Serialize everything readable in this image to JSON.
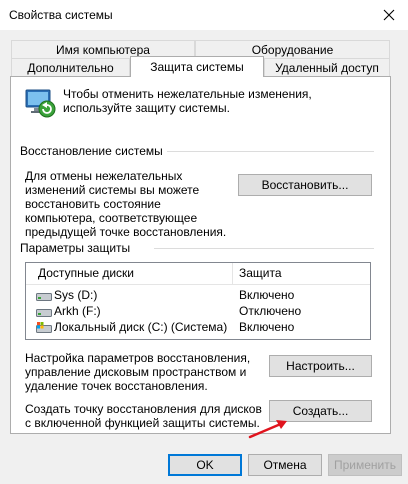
{
  "window": {
    "title": "Свойства системы"
  },
  "tabs": {
    "computer_name": "Имя компьютера",
    "hardware": "Оборудование",
    "advanced": "Дополнительно",
    "protection": "Защита системы",
    "remote": "Удаленный доступ"
  },
  "intro_text": "Чтобы отменить нежелательные изменения, используйте защиту системы.",
  "restore": {
    "group_title": "Восстановление системы",
    "description": "Для отмены нежелательных изменений системы вы можете восстановить состояние компьютера, соответствующее предыдущей точке восстановления.",
    "button_label": "Восстановить..."
  },
  "protection_settings": {
    "group_title": "Параметры защиты",
    "columns": {
      "drives": "Доступные диски",
      "protection": "Защита"
    },
    "drives": [
      {
        "name": "Sys (D:)",
        "status": "Включено",
        "icon": "drive-icon"
      },
      {
        "name": "Arkh (F:)",
        "status": "Отключено",
        "icon": "drive-icon"
      },
      {
        "name": "Локальный диск (C:) (Система)",
        "status": "Включено",
        "icon": "system-drive-icon"
      }
    ],
    "configure_text": "Настройка параметров восстановления, управление дисковым пространством и удаление точек восстановления.",
    "configure_button": "Настроить...",
    "create_text": "Создать точку восстановления для дисков с включенной функцией защиты системы.",
    "create_button": "Создать..."
  },
  "footer": {
    "ok": "OK",
    "cancel": "Отмена",
    "apply": "Применить"
  },
  "colors": {
    "arrow": "#e0141e",
    "accent": "#0078d7"
  }
}
